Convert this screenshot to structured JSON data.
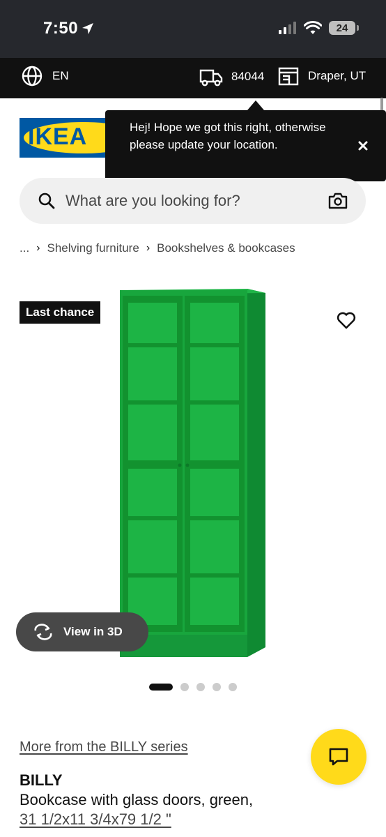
{
  "status_bar": {
    "time": "7:50",
    "battery": "24"
  },
  "topbar": {
    "language": "EN",
    "postal_code": "84044",
    "store": "Draper, UT"
  },
  "brand": {
    "logo_text": "IKEA",
    "colors": {
      "blue": "#0058a3",
      "yellow": "#ffda1a"
    }
  },
  "tooltip": {
    "message": "Hej! Hope we got this right, otherwise please update your location."
  },
  "search": {
    "placeholder": "What are you looking for?"
  },
  "breadcrumb": {
    "ellipsis": "...",
    "items": [
      "Shelving furniture",
      "Bookshelves & bookcases"
    ]
  },
  "product": {
    "badge": "Last chance",
    "view_3d_label": "View in 3D",
    "image_count": 5,
    "active_image": 1,
    "series_link": "More from the BILLY series",
    "name": "BILLY",
    "description": "Bookcase with glass doors, green,",
    "size": "31 1/2x11 3/4x79 1/2 \"",
    "product_color": "#18a63d"
  },
  "icons": {
    "location": "location-arrow-icon",
    "signal": "signal-icon",
    "wifi": "wifi-icon",
    "globe": "globe-icon",
    "truck": "delivery-truck-icon",
    "store": "store-icon",
    "close": "close-icon",
    "search": "search-icon",
    "camera": "camera-icon",
    "heart": "heart-icon",
    "rotate": "rotate-3d-icon",
    "chat": "chat-icon"
  }
}
